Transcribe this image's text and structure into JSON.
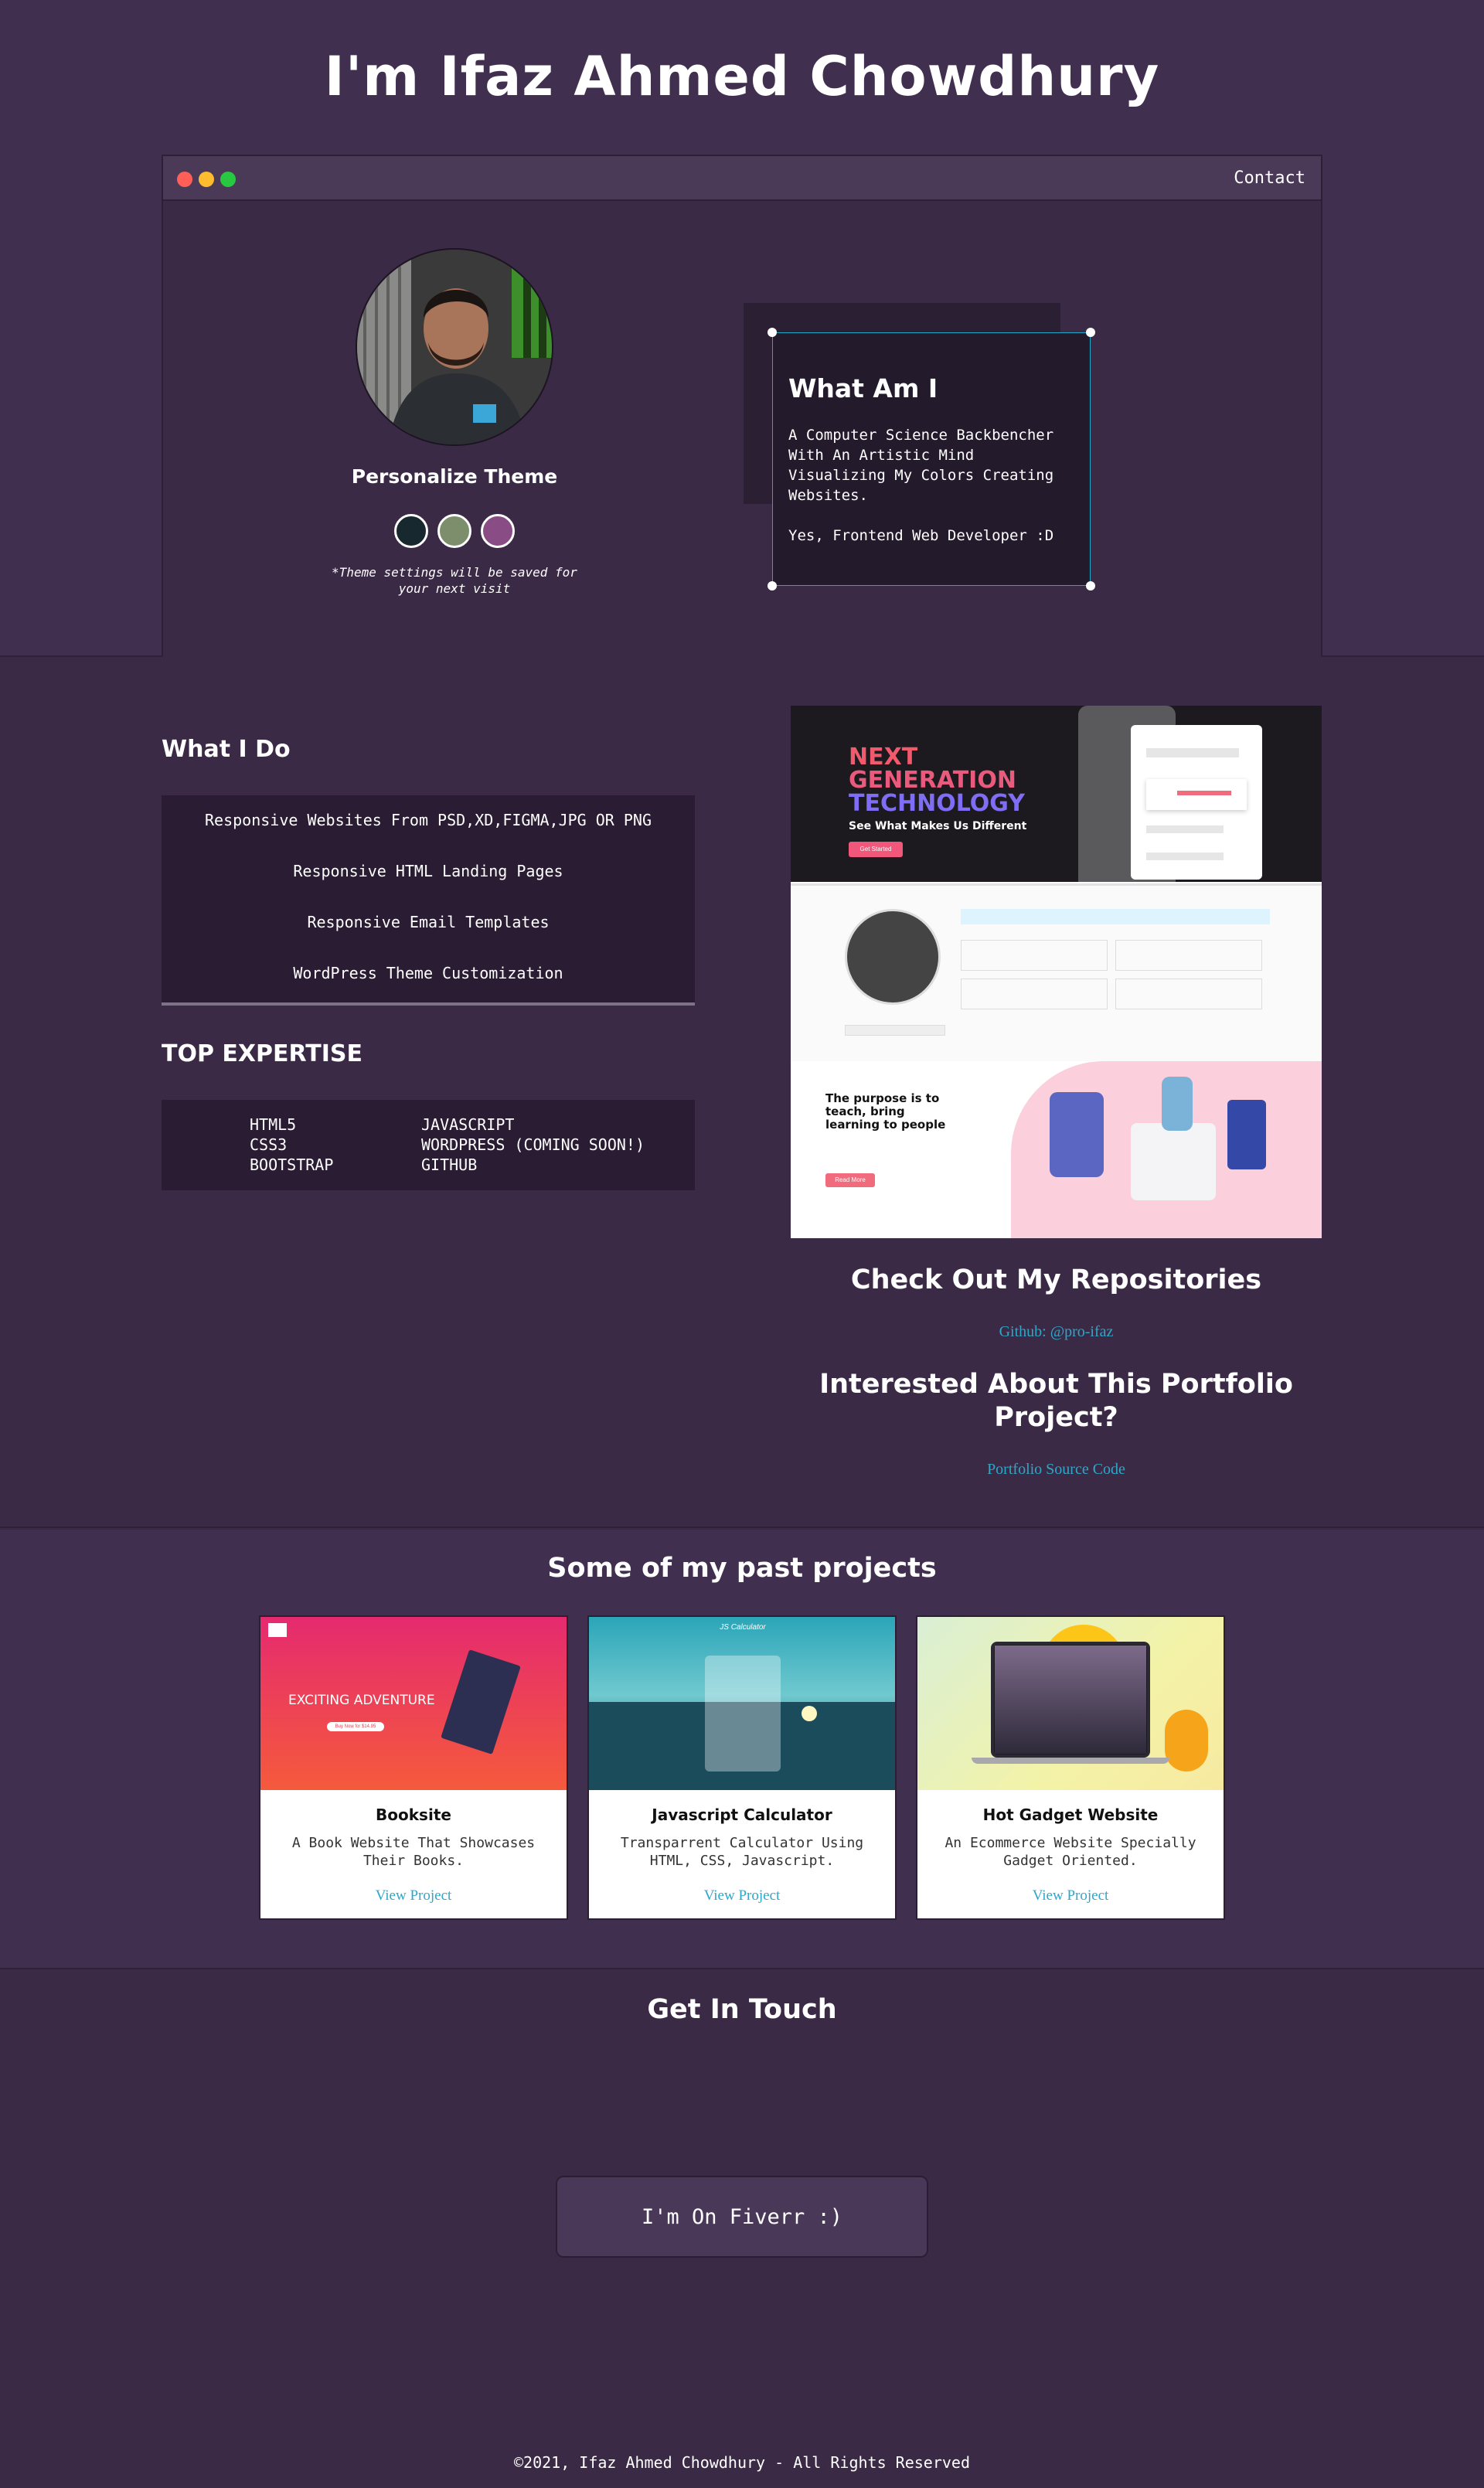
{
  "header": {
    "title": "I'm Ifaz Ahmed Chowdhury"
  },
  "window": {
    "contact_label": "Contact",
    "dot_colors": [
      "#ff5f57",
      "#febc2e",
      "#28c840"
    ]
  },
  "profile": {
    "theme_title": "Personalize Theme",
    "theme_swatches": [
      "#17282f",
      "#7c8e6c",
      "#8a4c84"
    ],
    "theme_note": "*Theme settings will be saved for your next visit"
  },
  "intro": {
    "heading": "What Am I",
    "paragraph_1": "A Computer Science Backbencher With An Artistic Mind Visualizing My Colors Creating Websites.",
    "paragraph_2": "Yes, Frontend Web Developer :D"
  },
  "about": {
    "what_i_do_title": "What I Do",
    "services": [
      "Responsive Websites From PSD,XD,FIGMA,JPG OR PNG",
      "Responsive HTML Landing Pages",
      "Responsive Email Templates",
      "WordPress Theme Customization"
    ],
    "expertise_title": "TOP EXPERTISE",
    "skills_left": [
      "HTML5",
      "CSS3",
      "BOOTSTRAP"
    ],
    "skills_right": [
      "JAVASCRIPT",
      "WORDPRESS (COMING SOON!)",
      "GITHUB"
    ]
  },
  "preview": {
    "hero_line_1": "NEXT",
    "hero_line_2": "GENERATION",
    "hero_line_3": "TECHNOLOGY",
    "hero_sub": "See What Makes Us Different",
    "hero_button": "Get Started",
    "teach_heading": "The purpose is to teach, bring learning to people",
    "teach_button": "Read More"
  },
  "links": {
    "repos_heading": "Check Out My Repositories",
    "repos_link": "Github: @pro-ifaz",
    "portfolio_heading": "Interested About This Portfolio Project?",
    "portfolio_link": "Portfolio Source Code"
  },
  "projects": {
    "title": "Some of my past projects",
    "items": [
      {
        "title": "Booksite",
        "description": "A Book Website That Showcases Their Books.",
        "link": "View Project",
        "thumb_text": "EXCITING ADVENTURE",
        "thumb_button": "Buy Now for $14.95"
      },
      {
        "title": "Javascript Calculator",
        "description": "Transparrent Calculator Using HTML, CSS, Javascript.",
        "link": "View Project",
        "thumb_text": "JS Calculator"
      },
      {
        "title": "Hot Gadget Website",
        "description": "An Ecommerce Website Specially Gadget Oriented.",
        "link": "View Project"
      }
    ]
  },
  "contact": {
    "title": "Get In Touch",
    "fiverr_label": "I'm On Fiverr :)"
  },
  "footer": {
    "text": "©2021, Ifaz Ahmed Chowdhury - All Rights Reserved"
  }
}
